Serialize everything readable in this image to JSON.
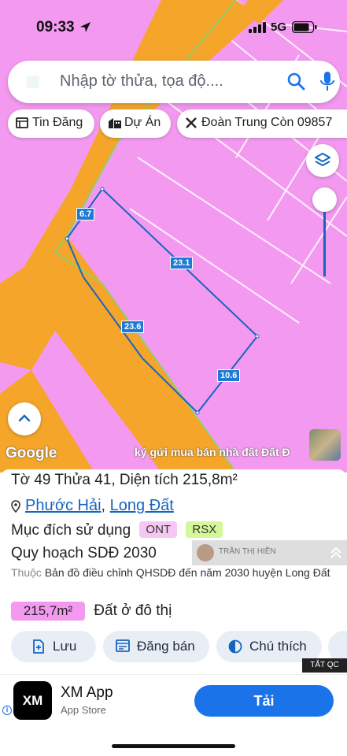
{
  "status_bar": {
    "time": "09:33",
    "network": "5G"
  },
  "search": {
    "placeholder": "Nhập tờ thửa, tọa độ...."
  },
  "chips": [
    {
      "label": "Tin Đăng",
      "icon": "listing-icon"
    },
    {
      "label": "Dự Án",
      "icon": "building-icon"
    },
    {
      "label": "Đoàn Trung Còn 09857",
      "icon": "tools-icon"
    }
  ],
  "map": {
    "dimensions": [
      "6.7",
      "23.1",
      "23.6",
      "10.6"
    ],
    "attribution": "Google",
    "ticker": "ký gửi mua bán nhà đất Đất Đ",
    "colors": {
      "residential": "#f39af0",
      "road": "#f5a52a",
      "parcel_line": "#1565c0"
    }
  },
  "parcel": {
    "sheet_label": "Tờ",
    "sheet": "49",
    "lot_label": "Thửa",
    "lot": "41",
    "area_label": "Diện tích",
    "area": "215,8m²",
    "ward": "Phước Hải",
    "district": "Long Đất",
    "purpose_label": "Mục đích sử dụng",
    "purpose_tags": [
      "ONT",
      "RSX"
    ],
    "plan_label": "Quy hoạch SDĐ 2030",
    "belongs_prefix": "Thuộc",
    "belongs_text": "Bản đồ điều chỉnh QHSDĐ đến năm 2030 huyện Long Đất",
    "overlay_name": "TRẦN THỊ HIỀN",
    "zone_area": "215,7m²",
    "zone_label": "Đất ở đô thị"
  },
  "actions": [
    {
      "label": "Lưu",
      "icon": "save-icon"
    },
    {
      "label": "Đăng bán",
      "icon": "sell-icon"
    },
    {
      "label": "Chú thích",
      "icon": "legend-icon"
    }
  ],
  "ad": {
    "close_label": "TẮT QC",
    "logo_text": "XM",
    "app_name": "XM App",
    "store": "App Store",
    "cta": "Tải"
  }
}
